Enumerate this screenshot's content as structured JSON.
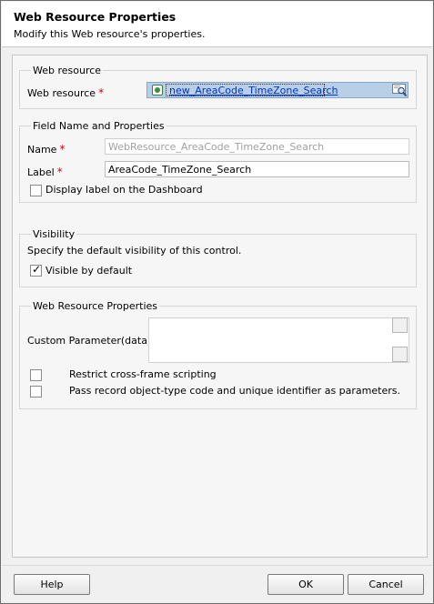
{
  "dialog": {
    "title": "Web Resource Properties",
    "subtitle": "Modify this Web resource's properties."
  },
  "web_resource_group": {
    "title": "Web resource",
    "field_label": "Web resource",
    "required_mark": "*",
    "value": "new_AreaCode_TimeZone_Search",
    "resource_icon": "web-resource-icon",
    "lookup_icon": "lookup-magnifier-icon"
  },
  "field_group": {
    "title": "Field Name and Properties",
    "name_label": "Name",
    "name_value": "WebResource_AreaCode_TimeZone_Search",
    "label_label": "Label",
    "label_value": "AreaCode_TimeZone_Search",
    "required_mark": "*",
    "dashboard_checkbox_label": "Display label on the Dashboard",
    "dashboard_checked": false
  },
  "visibility_group": {
    "title": "Visibility",
    "description": "Specify the default visibility of this control.",
    "visible_label": "Visible by default",
    "visible_checked": true
  },
  "properties_group": {
    "title": "Web Resource Properties",
    "custom_param_label": "Custom Parameter(data)",
    "custom_param_value": "",
    "restrict_label": "Restrict cross-frame scripting",
    "restrict_checked": false,
    "pass_record_label": "Pass record object-type code and unique identifier as parameters.",
    "pass_record_checked": false
  },
  "footer": {
    "help_label": "Help",
    "ok_label": "OK",
    "cancel_label": "Cancel"
  },
  "colors": {
    "required": "#d0021b",
    "link": "#0033cc",
    "lookup_highlight": "#b8cfe8"
  }
}
